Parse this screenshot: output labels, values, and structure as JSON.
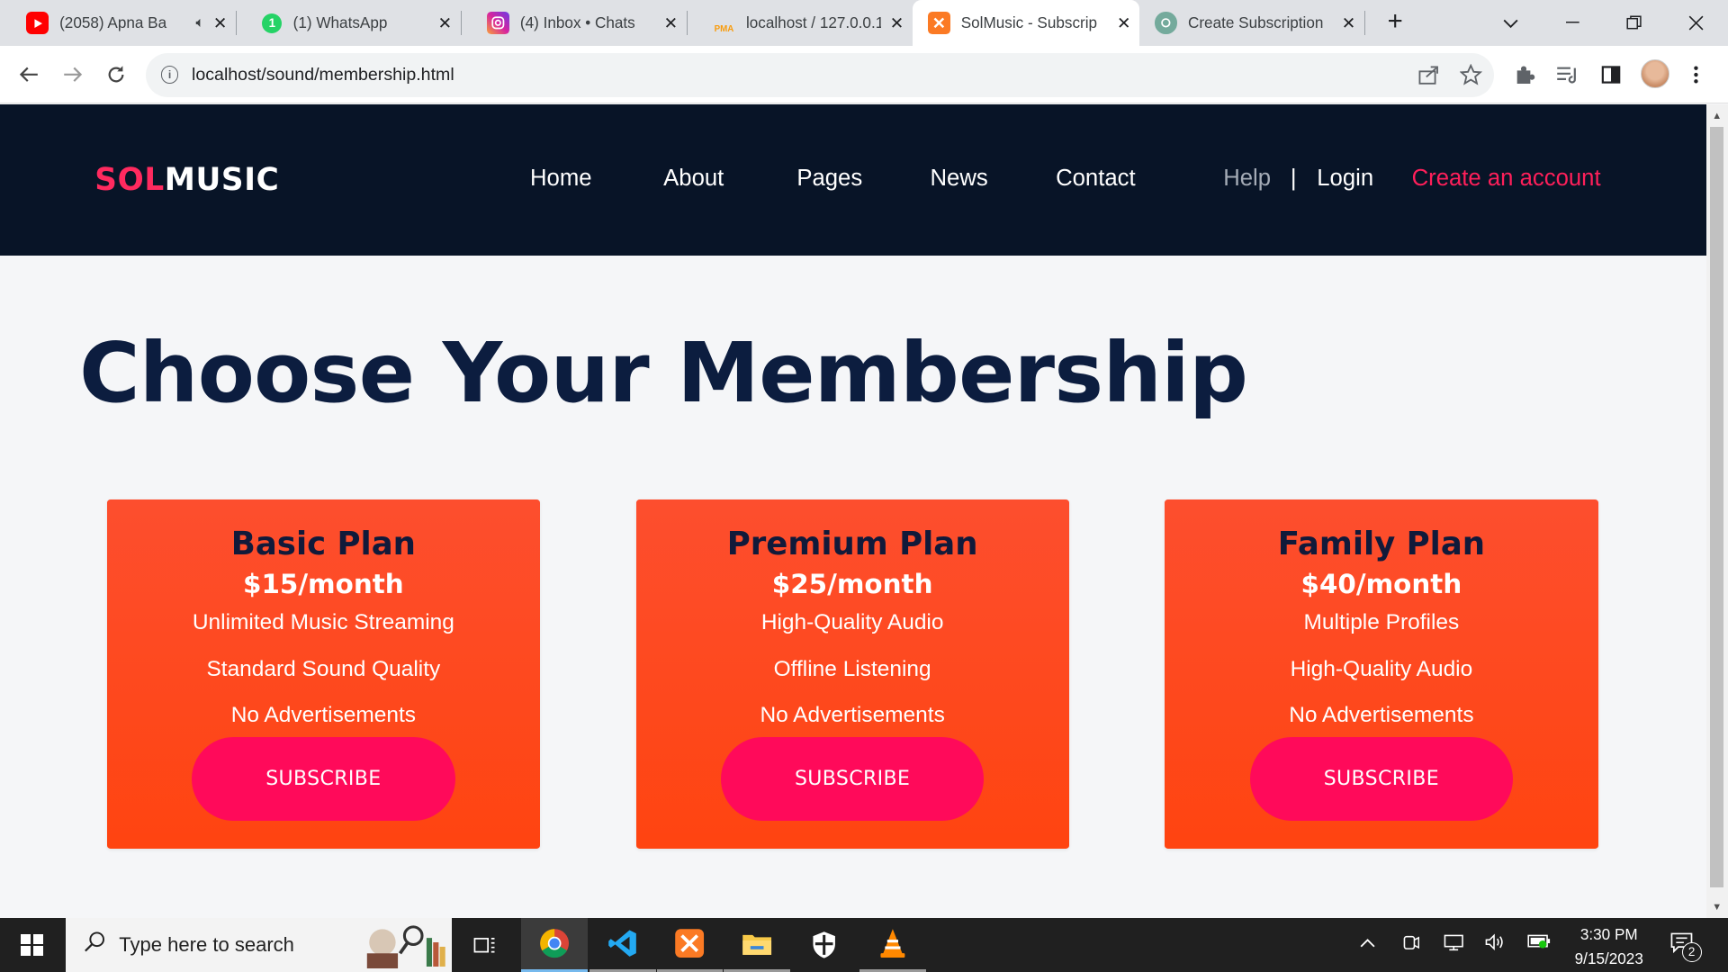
{
  "browser": {
    "tabs": [
      {
        "title": "(2058) Apna Ba",
        "favicon": "youtube-icon",
        "color": "#ff0000"
      },
      {
        "title": "(1) WhatsApp",
        "favicon": "whatsapp-icon",
        "color": "#25d366",
        "badge": "1"
      },
      {
        "title": "(4) Inbox • Chats",
        "favicon": "instagram-icon",
        "color": "#d6249f"
      },
      {
        "title": "localhost / 127.0.0.1",
        "favicon": "phpmyadmin-icon",
        "color": "#f89c0e",
        "badge": "PMA"
      },
      {
        "title": "SolMusic - Subscrip",
        "favicon": "xampp-icon",
        "color": "#fb7a24"
      },
      {
        "title": "Create Subscription",
        "favicon": "chatgpt-icon",
        "color": "#74aa9c"
      }
    ],
    "active_tab": 4,
    "url": "localhost/sound/membership.html"
  },
  "site": {
    "logo_primary": "SOL",
    "logo_secondary": "MUSIC",
    "brand_color": "#ff2a5f",
    "header_bg": "#081427",
    "nav": {
      "home": "Home",
      "about": "About",
      "pages": "Pages",
      "news": "News",
      "contact": "Contact",
      "help": "Help",
      "separator": "|",
      "login": "Login",
      "create_account": "Create an account"
    },
    "heading": "Choose Your Membership",
    "plans": [
      {
        "name": "Basic Plan",
        "price": "$15/month",
        "features": [
          "Unlimited Music Streaming",
          "Standard Sound Quality",
          "No Advertisements"
        ],
        "button": "SUBSCRIBE"
      },
      {
        "name": "Premium Plan",
        "price": "$25/month",
        "features": [
          "High-Quality Audio",
          "Offline Listening",
          "No Advertisements"
        ],
        "button": "SUBSCRIBE"
      },
      {
        "name": "Family Plan",
        "price": "$40/month",
        "features": [
          "Multiple Profiles",
          "High-Quality Audio",
          "No Advertisements"
        ],
        "button": "SUBSCRIBE"
      }
    ],
    "card_color": "#ff4a22",
    "button_color": "#ff0a5a"
  },
  "taskbar": {
    "search_placeholder": "Type here to search",
    "time": "3:30 PM",
    "date": "9/15/2023",
    "notification_count": "2"
  }
}
